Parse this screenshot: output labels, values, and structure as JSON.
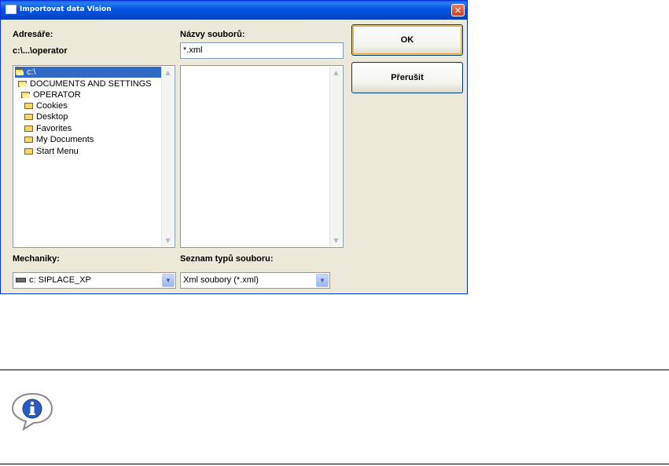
{
  "window": {
    "title": "Importovat data Vision",
    "close_label": "✕"
  },
  "directories": {
    "label": "Adresáře:",
    "current_path": "c:\\...\\operator",
    "items": [
      {
        "label": "c:\\",
        "icon": "open-folder-icon",
        "selected": true
      },
      {
        "label": "DOCUMENTS AND SETTINGS",
        "icon": "open-folder-icon",
        "selected": false
      },
      {
        "label": "OPERATOR",
        "icon": "open-folder-icon",
        "selected": false
      },
      {
        "label": "Cookies",
        "icon": "folder-icon",
        "selected": false
      },
      {
        "label": "Desktop",
        "icon": "folder-icon",
        "selected": false
      },
      {
        "label": "Favorites",
        "icon": "folder-icon",
        "selected": false
      },
      {
        "label": "My Documents",
        "icon": "folder-icon",
        "selected": false
      },
      {
        "label": "Start Menu",
        "icon": "folder-icon",
        "selected": false
      }
    ]
  },
  "files": {
    "label": "Názvy souborů:",
    "filter_value": "*.xml"
  },
  "buttons": {
    "ok_label": "OK",
    "cancel_label": "Přerušit"
  },
  "drives": {
    "label": "Mechaniky:",
    "selected": "c: SIPLACE_XP"
  },
  "file_types": {
    "label": "Seznam typů souboru:",
    "selected": "Xml soubory (*.xml)"
  },
  "colors": {
    "titlebar": "#0054e3",
    "dialog_bg": "#ece9d8",
    "selection": "#316ac5"
  }
}
